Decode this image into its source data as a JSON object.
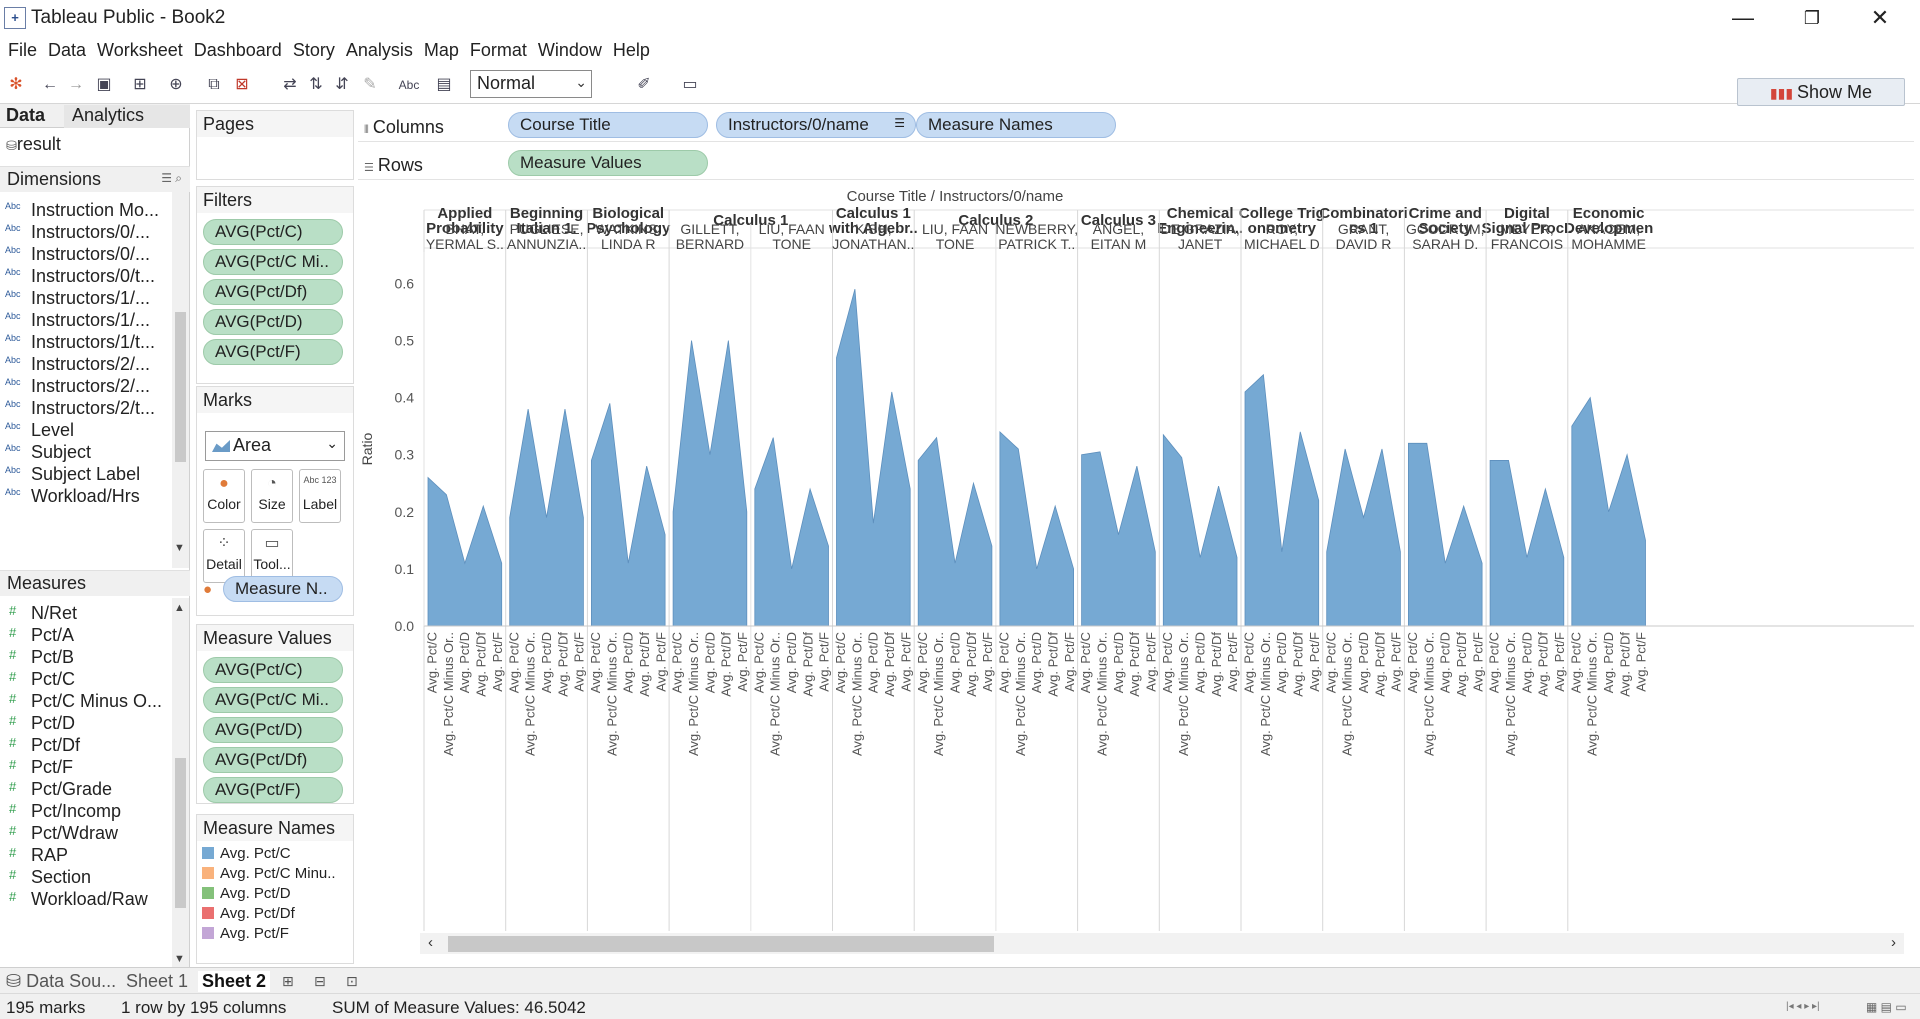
{
  "window": {
    "title": "Tableau Public - Book2",
    "minimize": "—",
    "restore": "❐",
    "close": "✕"
  },
  "menu": [
    "File",
    "Data",
    "Worksheet",
    "Dashboard",
    "Story",
    "Analysis",
    "Map",
    "Format",
    "Window",
    "Help"
  ],
  "toolbar": {
    "fit": "Normal",
    "show_me": "Show Me"
  },
  "left": {
    "tab_data": "Data",
    "tab_analytics": "Analytics",
    "datasource": "result",
    "dimensions_label": "Dimensions",
    "dim_type": "Abc",
    "dimensions": [
      "Instruction Mo...",
      "Instructors/0/...",
      "Instructors/0/...",
      "Instructors/0/t...",
      "Instructors/1/...",
      "Instructors/1/...",
      "Instructors/1/t...",
      "Instructors/2/...",
      "Instructors/2/...",
      "Instructors/2/t...",
      "Level",
      "Subject",
      "Subject Label",
      "Workload/Hrs"
    ],
    "measures_label": "Measures",
    "measures": [
      "N/Ret",
      "Pct/A",
      "Pct/B",
      "Pct/C",
      "Pct/C Minus O...",
      "Pct/D",
      "Pct/Df",
      "Pct/F",
      "Pct/Grade",
      "Pct/Incomp",
      "Pct/Wdraw",
      "RAP",
      "Section",
      "Workload/Raw"
    ]
  },
  "cards": {
    "pages": "Pages",
    "filters": "Filters",
    "filter_pills": [
      "AVG(Pct/C)",
      "AVG(Pct/C Mi..",
      "AVG(Pct/Df)",
      "AVG(Pct/D)",
      "AVG(Pct/F)"
    ],
    "marks": "Marks",
    "mark_type": "Area",
    "mark_buttons": [
      "Color",
      "Size",
      "Label",
      "Detail",
      "Tool..."
    ],
    "label_glyph": "Abc 123",
    "mark_pill": "Measure N..",
    "measure_values": "Measure Values",
    "mv_pills": [
      "AVG(Pct/C)",
      "AVG(Pct/C Mi..",
      "AVG(Pct/D)",
      "AVG(Pct/Df)",
      "AVG(Pct/F)"
    ],
    "measure_names": "Measure Names",
    "legend": [
      {
        "label": "Avg. Pct/C",
        "color": "#76a9d3"
      },
      {
        "label": "Avg. Pct/C Minu..",
        "color": "#f9b27c"
      },
      {
        "label": "Avg. Pct/D",
        "color": "#84c17a"
      },
      {
        "label": "Avg. Pct/Df",
        "color": "#ea7070"
      },
      {
        "label": "Avg. Pct/F",
        "color": "#c3a6d6"
      }
    ]
  },
  "shelves": {
    "columns_label": "Columns",
    "rows_label": "Rows",
    "columns": [
      "Course Title",
      "Instructors/0/name",
      "Measure Names"
    ],
    "rows": [
      "Measure Values"
    ]
  },
  "tabs": {
    "datasource": "Data Sou...",
    "sheet1": "Sheet 1",
    "sheet2": "Sheet 2"
  },
  "status": {
    "marks": "195 marks",
    "dims": "1 row by 195 columns",
    "sum": "SUM of Measure Values: 46.5042"
  },
  "chart_data": {
    "type": "area",
    "header_title": "Course Title  /  Instructors/0/name",
    "ylabel": "Ratio",
    "ylim": [
      0,
      0.62
    ],
    "yticks": [
      0.0,
      0.1,
      0.2,
      0.3,
      0.4,
      0.5,
      0.6
    ],
    "ytick_labels": [
      "0.0",
      "0.1",
      "0.2",
      "0.3",
      "0.4",
      "0.5",
      "0.6"
    ],
    "measure_labels": [
      "Avg. Pct/C",
      "Avg. Pct/C Minus Or..",
      "Avg. Pct/D",
      "Avg. Pct/Df",
      "Avg. Pct/F"
    ],
    "color": "#76a9d3",
    "courses": [
      {
        "title": [
          "Applied",
          "Probability"
        ],
        "instructors": [
          {
            "name": [
              "BHAT,",
              "YERMAL S.."
            ],
            "values": [
              0.26,
              0.23,
              0.11,
              0.21,
              0.11
            ]
          }
        ]
      },
      {
        "title": [
          "Beginning",
          "Italian 1."
        ],
        "instructors": [
          {
            "name": [
              "PUGLIESE,",
              "ANNUNZIA.."
            ],
            "values": [
              0.19,
              0.38,
              0.19,
              0.38,
              0.19
            ]
          }
        ]
      },
      {
        "title": [
          "Biological",
          "Psychology"
        ],
        "instructors": [
          {
            "name": [
              "WATKINS,",
              "LINDA R"
            ],
            "values": [
              0.29,
              0.39,
              0.11,
              0.28,
              0.16
            ]
          }
        ]
      },
      {
        "title": [
          "Calculus 1"
        ],
        "instructors": [
          {
            "name": [
              "GILLETT,",
              "BERNARD"
            ],
            "values": [
              0.2,
              0.5,
              0.3,
              0.5,
              0.2
            ]
          },
          {
            "name": [
              "LIU, FAAN",
              "TONE"
            ],
            "values": [
              0.24,
              0.33,
              0.1,
              0.24,
              0.14
            ]
          }
        ]
      },
      {
        "title": [
          "Calculus 1",
          "with Algebr.."
        ],
        "instructors": [
          {
            "name": [
              "KISH,",
              "JONATHAN.."
            ],
            "values": [
              0.47,
              0.59,
              0.18,
              0.41,
              0.24
            ]
          }
        ]
      },
      {
        "title": [
          "Calculus 2"
        ],
        "instructors": [
          {
            "name": [
              "LIU, FAAN",
              "TONE"
            ],
            "values": [
              0.29,
              0.33,
              0.11,
              0.25,
              0.14
            ]
          },
          {
            "name": [
              "NEWBERRY,",
              "PATRICK T.."
            ],
            "values": [
              0.34,
              0.31,
              0.1,
              0.21,
              0.1
            ]
          }
        ]
      },
      {
        "title": [
          "Calculus 3"
        ],
        "instructors": [
          {
            "name": [
              "ANGEL,",
              "EITAN M"
            ],
            "values": [
              0.3,
              0.305,
              0.16,
              0.28,
              0.13
            ]
          }
        ]
      },
      {
        "title": [
          "Chemical",
          "Engineerin.."
        ],
        "instructors": [
          {
            "name": [
              "DE GRAZIA,",
              "JANET"
            ],
            "values": [
              0.335,
              0.295,
              0.12,
              0.245,
              0.12
            ]
          }
        ]
      },
      {
        "title": [
          "College Trig",
          "onometry"
        ],
        "instructors": [
          {
            "name": [
              "ROY,",
              "MICHAEL D"
            ],
            "values": [
              0.41,
              0.44,
              0.13,
              0.34,
              0.22
            ]
          }
        ]
      },
      {
        "title": [
          "Combinatori",
          "cs 1"
        ],
        "instructors": [
          {
            "name": [
              "GRANT,",
              "DAVID R"
            ],
            "values": [
              0.13,
              0.31,
              0.19,
              0.31,
              0.13
            ]
          }
        ]
      },
      {
        "title": [
          "Crime and",
          "Society"
        ],
        "instructors": [
          {
            "name": [
              "GOODRUM,",
              "SARAH D."
            ],
            "values": [
              0.32,
              0.32,
              0.11,
              0.21,
              0.11
            ]
          }
        ]
      },
      {
        "title": [
          "Digital",
          "Signal Proc.."
        ],
        "instructors": [
          {
            "name": [
              "MEYER,",
              "FRANCOIS"
            ],
            "values": [
              0.29,
              0.29,
              0.12,
              0.24,
              0.12
            ]
          }
        ]
      },
      {
        "title": [
          "Economic",
          "Developmen"
        ],
        "instructors": [
          {
            "name": [
              "AKACEM,",
              "MOHAMME"
            ],
            "values": [
              0.35,
              0.4,
              0.2,
              0.3,
              0.15
            ]
          }
        ]
      }
    ]
  }
}
